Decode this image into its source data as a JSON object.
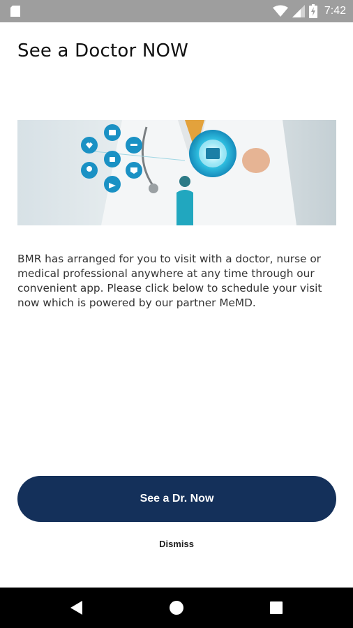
{
  "status_bar": {
    "time": "7:42",
    "icons": [
      "sd-card-icon",
      "wifi-icon",
      "signal-icon",
      "battery-charging-icon"
    ]
  },
  "page": {
    "title": "See a Doctor NOW",
    "hero_image": "doctor-medical-icons-image",
    "description": "BMR has arranged for you to visit with a doctor, nurse or medical professional anywhere at any time through our convenient app. Please click below to schedule your visit now which is powered by our partner MeMD."
  },
  "actions": {
    "primary_label": "See a Dr. Now",
    "dismiss_label": "Dismiss"
  },
  "colors": {
    "primary_button": "#14305a",
    "status_bar": "#9e9e9e",
    "nav_bar": "#000000"
  },
  "nav": {
    "icons": [
      "back-icon",
      "home-icon",
      "recents-icon"
    ]
  }
}
